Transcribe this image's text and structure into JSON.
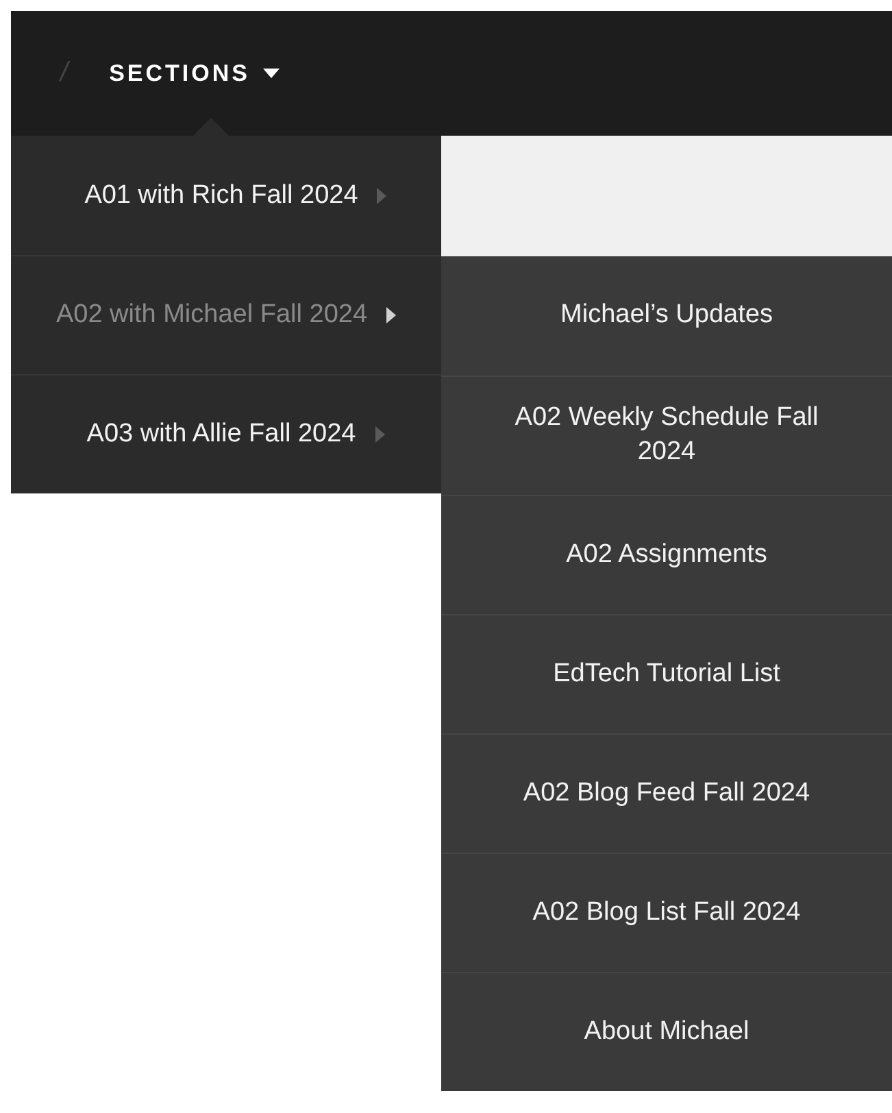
{
  "navbar": {
    "separator": "/",
    "menu_label": "SECTIONS"
  },
  "sections": [
    {
      "label": "A01 with Rich Fall 2024",
      "selected": false
    },
    {
      "label": "A02 with Michael Fall 2024",
      "selected": true,
      "children": [
        {
          "label": "Michael’s Updates"
        },
        {
          "label": "A02 Weekly Schedule Fall 2024"
        },
        {
          "label": "A02 Assignments"
        },
        {
          "label": "EdTech Tutorial List"
        },
        {
          "label": "A02 Blog Feed Fall 2024"
        },
        {
          "label": "A02 Blog List Fall 2024"
        },
        {
          "label": "About Michael"
        }
      ]
    },
    {
      "label": "A03 with Allie Fall 2024",
      "selected": false
    }
  ]
}
